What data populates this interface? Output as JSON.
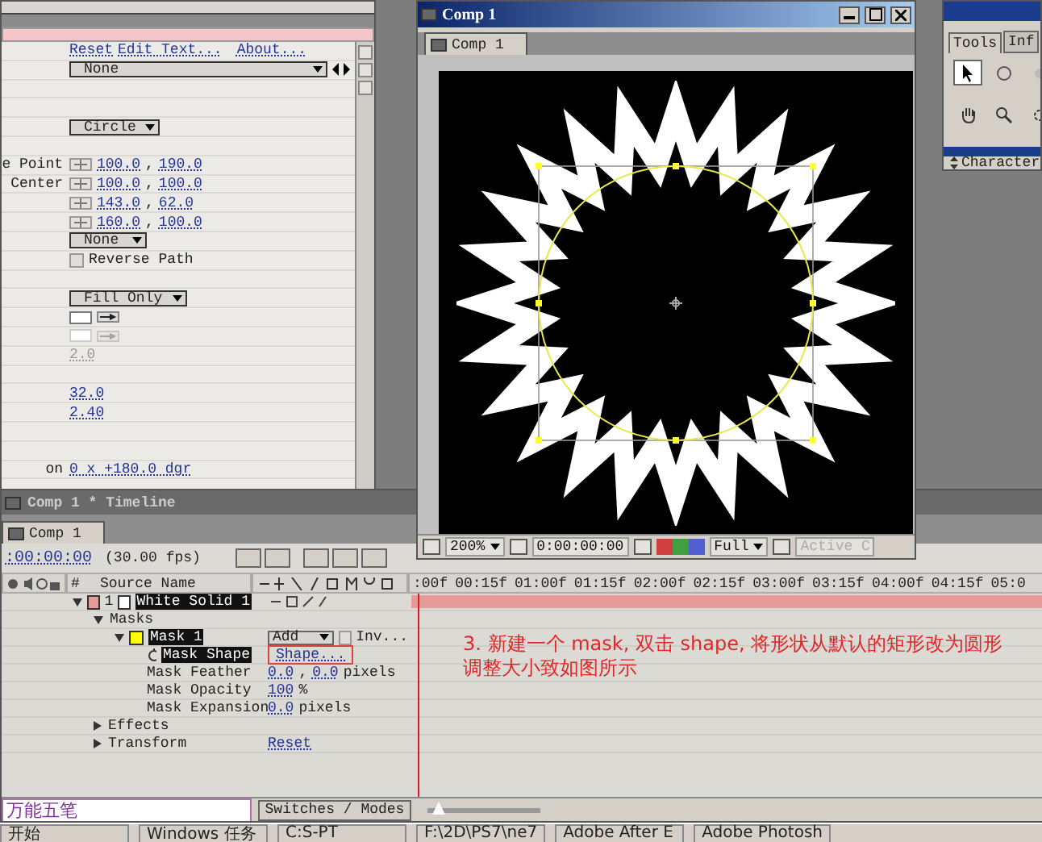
{
  "effect_controls": {
    "rows": [
      {
        "kind": "links",
        "links": [
          "Reset",
          "Edit Text...",
          "About..."
        ]
      },
      {
        "kind": "preset",
        "value": "None"
      },
      {
        "kind": "blank"
      },
      {
        "kind": "blank"
      },
      {
        "kind": "dropdown",
        "value": "Circle"
      },
      {
        "kind": "blank"
      },
      {
        "kind": "point",
        "label": "e Point",
        "values": [
          "100.0",
          "190.0"
        ],
        "separator": ","
      },
      {
        "kind": "point",
        "label": "Center",
        "values": [
          "100.0",
          "100.0"
        ],
        "separator": ","
      },
      {
        "kind": "point",
        "values": [
          "143.0",
          "62.0"
        ],
        "separator": ","
      },
      {
        "kind": "point",
        "values": [
          "160.0",
          "100.0"
        ],
        "separator": ","
      },
      {
        "kind": "dropdown",
        "value": "None"
      },
      {
        "kind": "checkbox",
        "label": "Reverse Path",
        "checked": false
      },
      {
        "kind": "blank"
      },
      {
        "kind": "dropdown",
        "value": "Fill Only"
      },
      {
        "kind": "color",
        "disabled": false
      },
      {
        "kind": "color",
        "disabled": true
      },
      {
        "kind": "number",
        "value": "2.0",
        "disabled": true
      },
      {
        "kind": "blank"
      },
      {
        "kind": "number",
        "value": "32.0",
        "disabled": false
      },
      {
        "kind": "number",
        "value": "2.40",
        "disabled": false
      },
      {
        "kind": "blank"
      },
      {
        "kind": "blank"
      },
      {
        "kind": "angle",
        "label": "on",
        "value": "0 x +180.0 dgr"
      }
    ]
  },
  "comp_window": {
    "title": "Comp 1",
    "tab": "Comp 1",
    "zoom": "200%",
    "timecode": "0:00:00:00",
    "resolution": "Full",
    "view": "Active C"
  },
  "tools_palette": {
    "tabs": [
      {
        "label": "Tools",
        "selected": true
      },
      {
        "label": "Inf",
        "selected": false
      }
    ]
  },
  "character_panel": {
    "title": "Character"
  },
  "timeline": {
    "title": "Comp 1 * Timeline",
    "tab": "Comp 1",
    "timecode": ":00:00:00",
    "fps": "(30.00 fps)",
    "number_header": "#",
    "source_header": "Source Name",
    "ruler": [
      ":00f",
      "00:15f",
      "01:00f",
      "01:15f",
      "02:00f",
      "02:15f",
      "03:00f",
      "03:15f",
      "04:00f",
      "04:15f",
      "05:0"
    ],
    "layers": [
      {
        "number": "1",
        "name": "White Solid 1",
        "color": "#e89a9a",
        "selected": true,
        "expanded": true,
        "children": [
          {
            "name": "Masks",
            "expanded": true,
            "children": [
              {
                "name": "Mask 1",
                "color": "#ffff00",
                "selected": true,
                "expanded": true,
                "mode": "Add",
                "inverted": false,
                "inverted_label": "Inv...",
                "children": [
                  {
                    "name": "Mask Shape",
                    "kind": "link",
                    "selected": true,
                    "value": "Shape..."
                  },
                  {
                    "name": "Mask Feather",
                    "kind": "values",
                    "selected": false,
                    "values": [
                      "0.0",
                      "0.0"
                    ],
                    "separator": ",",
                    "unit": "pixels"
                  },
                  {
                    "name": "Mask Opacity",
                    "kind": "values",
                    "selected": false,
                    "values": [
                      "100"
                    ],
                    "unit": "%"
                  },
                  {
                    "name": "Mask Expansion",
                    "kind": "values",
                    "selected": false,
                    "values": [
                      "0.0"
                    ],
                    "unit": "pixels"
                  }
                ]
              }
            ]
          },
          {
            "name": "Effects",
            "expanded": false
          },
          {
            "name": "Transform",
            "expanded": false,
            "value": "Reset"
          }
        ]
      }
    ],
    "zoom_slider": {
      "level": 0.1
    },
    "switches_label": "Switches / Modes",
    "ime": "万能五笔"
  },
  "annotation": {
    "lines": [
      "3. 新建一个 mask, 双击 shape, 将形状从默认的矩形改为圆形",
      "调整大小致如图所示"
    ]
  },
  "taskbar": {
    "start": "开始",
    "items": [
      "Windows 任务",
      "C:S-PT",
      "F:\\2D\\PS7\\ne7",
      "Adobe After E",
      "Adobe Photosh"
    ]
  }
}
